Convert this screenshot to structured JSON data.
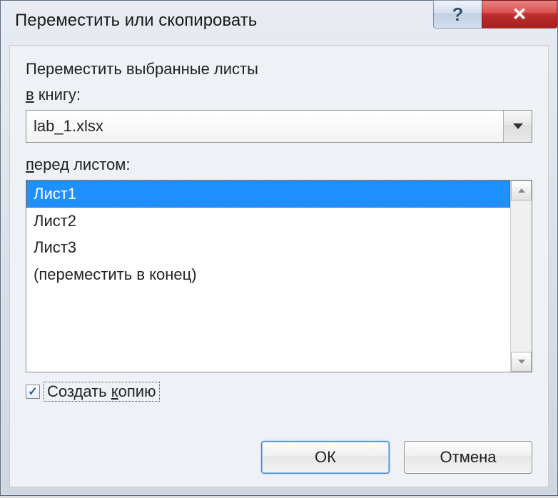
{
  "window": {
    "title": "Переместить или скопировать"
  },
  "titlebar_buttons": {
    "help_name": "help-button",
    "close_name": "close-button"
  },
  "instruction": "Переместить выбранные листы",
  "book_label_pre_underline": "",
  "book_label_underline": "в",
  "book_label_rest": " книгу:",
  "combo": {
    "value": "lab_1.xlsx"
  },
  "before_label_pre": "",
  "before_label_underline": "п",
  "before_label_rest": "еред листом:",
  "list_items": [
    "Лист1",
    "Лист2",
    "Лист3",
    "(переместить в конец)"
  ],
  "selected_index": 0,
  "checkbox": {
    "checked": true,
    "label_pre": "Создать ",
    "label_underline": "к",
    "label_rest": "опию"
  },
  "buttons": {
    "ok": "ОК",
    "cancel": "Отмена"
  }
}
